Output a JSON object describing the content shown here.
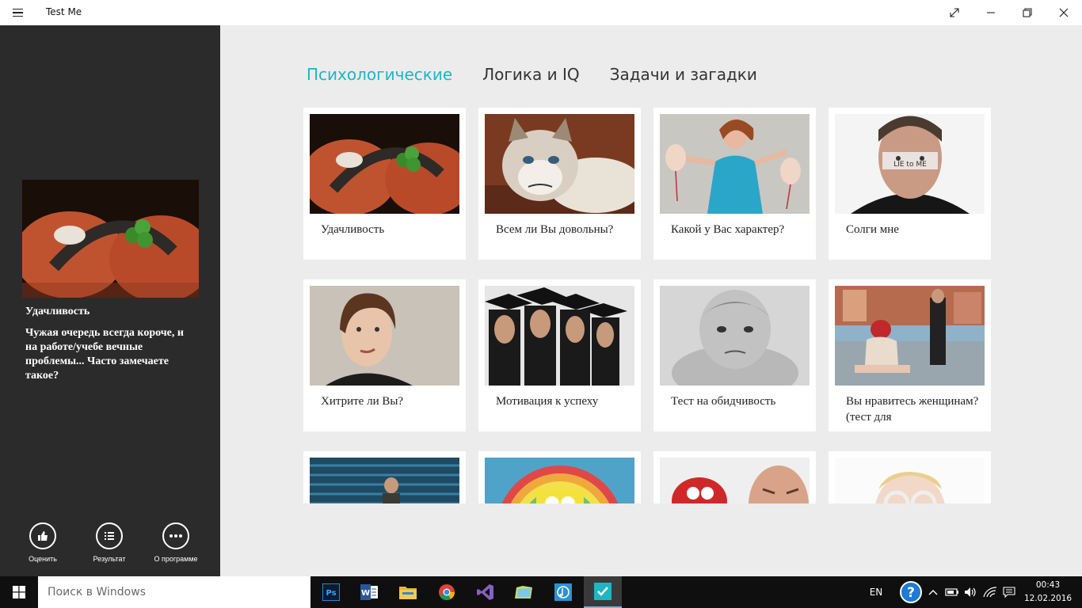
{
  "window": {
    "title": "Test Me"
  },
  "sidebar": {
    "selected_title": "Удачливость",
    "selected_description": "Чужая очередь всегда короче, и на работе/учебе вечные проблемы... Часто замечаете такое?",
    "actions": [
      {
        "label": "Оценить",
        "icon": "thumbs-up-icon"
      },
      {
        "label": "Результат",
        "icon": "list-icon"
      },
      {
        "label": "О программе",
        "icon": "more-icon"
      }
    ]
  },
  "tabs": [
    {
      "label": "Психологические",
      "active": true
    },
    {
      "label": "Логика и IQ",
      "active": false
    },
    {
      "label": "Задачи и загадки",
      "active": false
    }
  ],
  "tests": [
    {
      "title": "Удачливость",
      "image": "horseshoe-hands"
    },
    {
      "title": "Всем ли Вы довольны?",
      "image": "grumpy-cat"
    },
    {
      "title": "Какой у Вас характер?",
      "image": "woman-with-masks"
    },
    {
      "title": "Солги мне",
      "image": "lie-to-me-poster"
    },
    {
      "title": "Хитрите ли Вы?",
      "image": "woman-thinking"
    },
    {
      "title": "Мотивация к успеху",
      "image": "graduates"
    },
    {
      "title": "Тест на обидчивость",
      "image": "angry-child"
    },
    {
      "title": "Вы нравитесь женщинам? (тест для",
      "image": "girl-on-street"
    },
    {
      "title": "",
      "image": "man-in-stadium"
    },
    {
      "title": "",
      "image": "sponge-rainbow"
    },
    {
      "title": "",
      "image": "red-toy-man"
    },
    {
      "title": "",
      "image": "baby-glasses"
    }
  ],
  "taskbar": {
    "search_placeholder": "Поиск в Windows",
    "apps": [
      "photoshop-icon",
      "word-icon",
      "file-explorer-icon",
      "chrome-icon",
      "visual-studio-icon",
      "folder-app-icon",
      "music-app-icon",
      "test-me-app-icon"
    ],
    "language": "EN",
    "time": "00:43",
    "date": "12.02.2016"
  },
  "colors": {
    "accent": "#1fb5c5",
    "sidebar_bg": "#2b2b2b",
    "content_bg": "#ececec",
    "taskbar_bg": "#0f0f0f"
  }
}
